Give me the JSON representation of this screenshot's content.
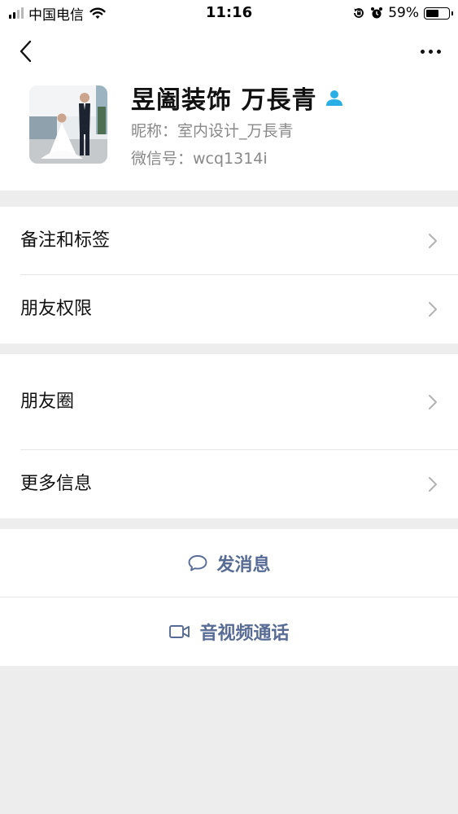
{
  "status_bar": {
    "carrier": "中国电信",
    "time": "11:16",
    "battery_percent": "59%",
    "battery_level": 0.59,
    "icons": [
      "signal-icon",
      "wifi-icon",
      "rotation-lock-icon",
      "alarm-icon",
      "battery-icon"
    ]
  },
  "nav": {
    "back_icon": "chevron-left-icon",
    "more_icon": "more-dots-icon"
  },
  "profile": {
    "name": "昱阖装饰 万長青",
    "nickname": "昵称：室内设计_万長青",
    "wechat_id": "微信号：wcq1314i",
    "badge_icon": "contact-person-icon",
    "badge_color": "#2aaee6"
  },
  "menu": {
    "group1": [
      "备注和标签",
      "朋友权限"
    ],
    "group2": [
      "朋友圈",
      "更多信息"
    ]
  },
  "actions": {
    "send_message": "发消息",
    "video_call": "音视频通话",
    "link_color": "#576b95"
  }
}
